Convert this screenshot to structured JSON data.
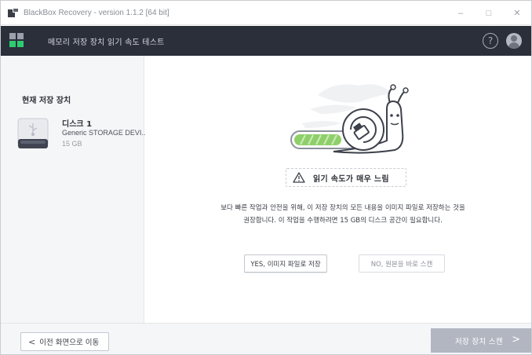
{
  "window": {
    "title": "BlackBox Recovery - version 1.1.2 [64 bit]",
    "minimize_glyph": "–",
    "maximize_glyph": "□",
    "close_glyph": "✕"
  },
  "header": {
    "title": "메모리 저장 장치 읽기 속도 테스트",
    "help_glyph": "?",
    "icons": [
      "app-logo-icon",
      "help-icon",
      "user-icon"
    ]
  },
  "sidebar": {
    "heading": "현재 저장 장치",
    "device": {
      "name": "디스크 1",
      "model": "Generic STORAGE DEVI...",
      "size": "15 GB",
      "icon": "usb-drive-icon"
    }
  },
  "main": {
    "illustration": "snail-progress-illustration",
    "warning": "읽기 속도가 매우 느림",
    "message_line1": "보다 빠른 작업과 안전을 위해, 이 저장 장치의 모든 내용을 이미지 파일로 저장하는 것을",
    "message_line2": "권장합니다. 이 작업을 수행하려면 15 GB의 디스크 공간이 필요합니다.",
    "yes_button": "YES, 이미지 파일로 저장",
    "no_button": "NO, 원본을 바로 스캔"
  },
  "footer": {
    "back_button": "이전 화면으로 이동",
    "back_chevron": "<",
    "scan_button": "저장 장치 스캔",
    "scan_chevron": ">"
  },
  "colors": {
    "header_bg": "#2b2f3a",
    "sidebar_bg": "#f5f6f8",
    "scan_button_bg": "#b2b6c1",
    "progress_green": "#8fcf6b"
  }
}
